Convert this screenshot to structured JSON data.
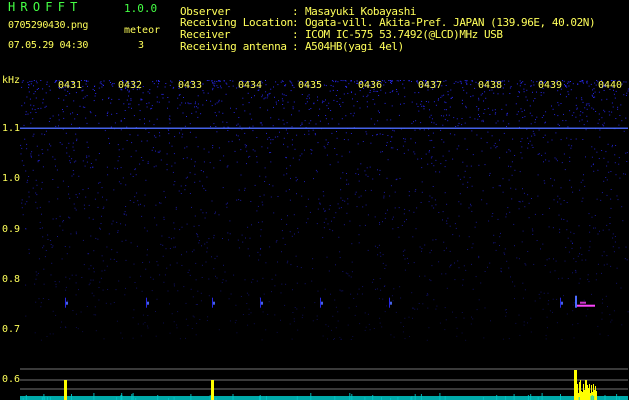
{
  "header": {
    "app_title": "HROFFT",
    "version": "1.0.0",
    "file_name": "0705290430.png",
    "meteor_label": "meteor",
    "timestamp": "07.05.29 04:30",
    "meteor_count": "3"
  },
  "station_info": [
    {
      "label": "Observer",
      "value": "Masayuki Kobayashi"
    },
    {
      "label": "Receiving Location",
      "value": "Ogata-vill. Akita-Pref. JAPAN (139.96E, 40.02N)"
    },
    {
      "label": "Receiver",
      "value": "ICOM IC-575 53.7492(@LCD)MHz USB"
    },
    {
      "label": "Receiving antenna",
      "value": "A504HB(yagi 4el)"
    }
  ],
  "spectrogram": {
    "unit_label": "kHz",
    "time_labels": [
      "0431",
      "0432",
      "0433",
      "0434",
      "0435",
      "0436",
      "0437",
      "0438",
      "0439",
      "0440"
    ],
    "freq_labels": [
      "1.1",
      "1.0",
      "0.9",
      "0.8",
      "0.7",
      "0.6"
    ],
    "freq_values": [
      1.1,
      1.0,
      0.9,
      0.8,
      0.7,
      0.6
    ],
    "colors": {
      "background": "#000000",
      "noise": "#2a2aff",
      "carrier": "#4b6bff",
      "echo": "#ff44ff",
      "grid": "#9a9a9a",
      "level_bar": "#ffff00",
      "level_base": "#00c8c8"
    },
    "meteor_events_minutes": [
      0.25,
      2.7,
      8.75
    ]
  }
}
